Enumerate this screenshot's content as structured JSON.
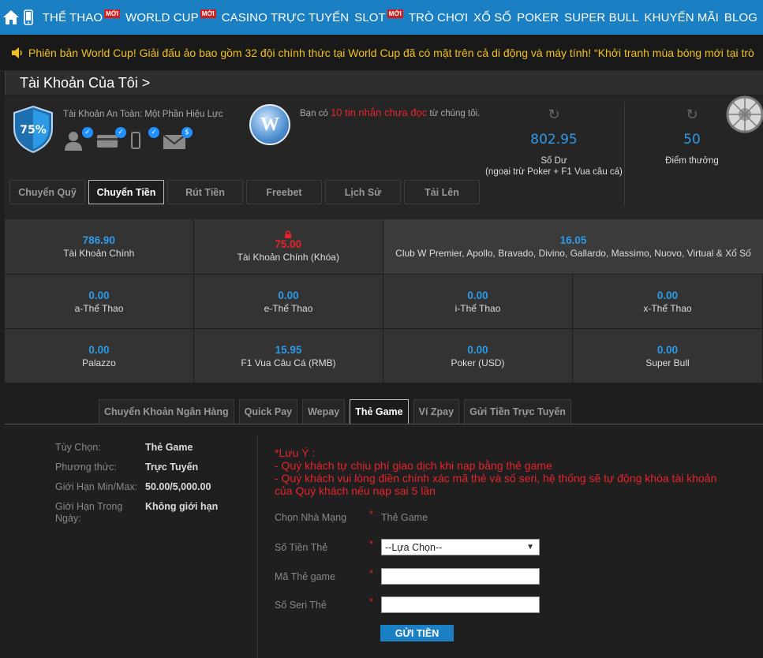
{
  "nav": {
    "items": [
      {
        "label": "THỂ THAO",
        "badge": "MỚI"
      },
      {
        "label": "WORLD CUP",
        "badge": "MỚI"
      },
      {
        "label": "CASINO TRỰC TUYẾN",
        "badge": ""
      },
      {
        "label": "SLOT",
        "badge": "MỚI"
      },
      {
        "label": "TRÒ CHƠI",
        "badge": ""
      },
      {
        "label": "XỔ SỐ",
        "badge": ""
      },
      {
        "label": "POKER",
        "badge": ""
      },
      {
        "label": "SUPER BULL",
        "badge": ""
      },
      {
        "label": "KHUYẾN MÃI",
        "badge": ""
      },
      {
        "label": "BLOG",
        "badge": ""
      }
    ]
  },
  "marquee": {
    "text": "Phiên bản World Cup! Giải đấu ảo bao gồm 32 đội chính thức tại World Cup đã có mặt trên cả di động và máy tính!  “Khởi tranh mùa bóng mới tại trò"
  },
  "account": {
    "title": "Tài Khoản Của Tôi >",
    "security_percent": "75%",
    "security_label": "Tài Khoản An Toàn: Một Phần Hiệu Lực",
    "message_prefix": "Bạn có",
    "message_highlight": "10 tin nhắn chưa đọc",
    "message_suffix": "từ chúng tôi.",
    "balance_value": "802.95",
    "balance_label": "Số Dư\n(ngoại trừ Poker + F1 Vua câu cá)",
    "points_value": "50",
    "points_label": "Điểm thưởng",
    "logo_letter": "W"
  },
  "tabs": [
    {
      "label": "Chuyển Quỹ",
      "active": false
    },
    {
      "label": "Chuyển Tiền",
      "active": true
    },
    {
      "label": "Rút Tiền",
      "active": false
    },
    {
      "label": "Freebet",
      "active": false
    },
    {
      "label": "Lịch Sử",
      "active": false
    },
    {
      "label": "Tải Lên",
      "active": false
    }
  ],
  "wallets_top": [
    {
      "amount": "786.90",
      "name": "Tài Khoản Chính",
      "locked": false
    },
    {
      "amount": "75.00",
      "name": "Tài Khoản Chính (Khóa)",
      "locked": true
    },
    {
      "amount": "16.05",
      "name": "Club W Premier, Apollo, Bravado, Divino, Gallardo, Massimo, Nuovo, Virtual & Xổ Số",
      "locked": false
    }
  ],
  "wallets": [
    {
      "amount": "0.00",
      "name": "a-Thể Thao"
    },
    {
      "amount": "0.00",
      "name": "e-Thể Thao"
    },
    {
      "amount": "0.00",
      "name": "i-Thể Thao"
    },
    {
      "amount": "0.00",
      "name": "x-Thể Thao"
    },
    {
      "amount": "0.00",
      "name": "Palazzo"
    },
    {
      "amount": "15.95",
      "name": "F1 Vua Câu Cá (RMB)"
    },
    {
      "amount": "0.00",
      "name": "Poker (USD)"
    },
    {
      "amount": "0.00",
      "name": "Super Bull"
    }
  ],
  "methods": [
    {
      "label": "Chuyển Khoản Ngân Hàng",
      "active": false
    },
    {
      "label": "Quick Pay",
      "active": false
    },
    {
      "label": "Wepay",
      "active": false
    },
    {
      "label": "Thẻ Game",
      "active": true
    },
    {
      "label": "Ví Zpay",
      "active": false
    },
    {
      "label": "Gửi Tiền Trực Tuyến",
      "active": false
    }
  ],
  "info": [
    {
      "k": "Tùy Chọn:",
      "v": "Thẻ Game"
    },
    {
      "k": "Phương thức:",
      "v": "Trực Tuyến"
    },
    {
      "k": "Giới Hạn Min/Max:",
      "v": "50.00/5,000.00"
    },
    {
      "k": "Giới Hạn Trong Ngày:",
      "v": "Không giới hạn"
    }
  ],
  "note": {
    "title": "*Lưu Ý :",
    "line1": "- Quý khách tự chịu phí giao dịch khi nạp bằng thẻ game",
    "line2": "- Quý khách vui lòng điền chính xác mã thẻ và số seri, hệ thống sẽ tự động khóa tài khoản của Quý khách nếu nạp sai 5 lần"
  },
  "form": {
    "provider_label": "Chọn Nhà Mạng",
    "provider_value": "Thẻ Game",
    "amount_label": "Số Tiền Thẻ",
    "amount_value": "--Lựa Chọn--",
    "code_label": "Mã Thẻ game",
    "serial_label": "Số Seri Thẻ",
    "star": "*",
    "submit_label": "GỬI TIỀN"
  },
  "colors": {
    "nav_bg": "#1b7fc4",
    "accent_blue": "#2d9ae8",
    "alert_red": "#e8232b",
    "marquee_text": "#f0c020"
  }
}
